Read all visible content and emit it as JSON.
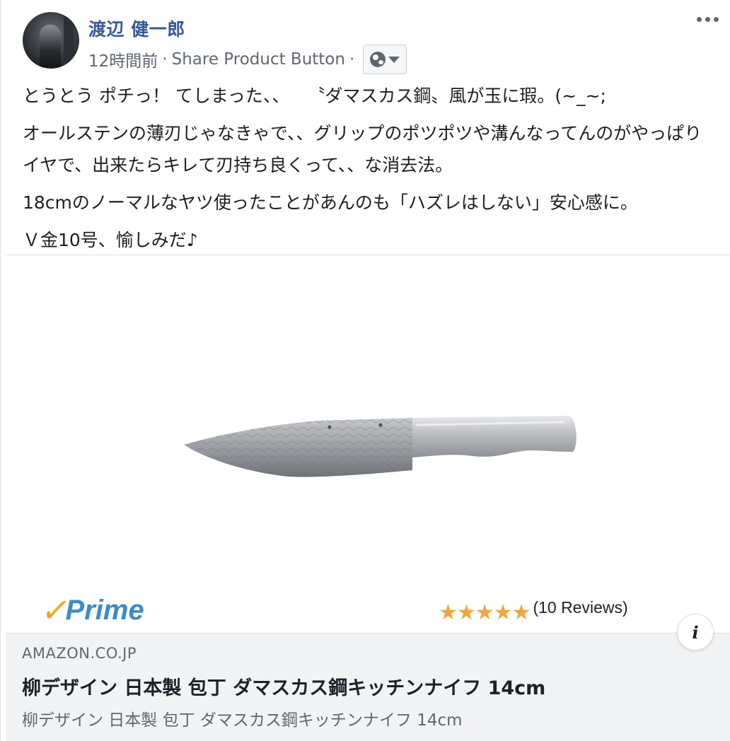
{
  "post": {
    "author": "渡辺 健一郎",
    "time": "12時間前",
    "separator": "·",
    "via": "Share Product Button",
    "audience_icon": "globe-icon",
    "more_icon": "more-options-icon",
    "body": [
      "とうとう ポチっ！ てしまった、、　　〝ダマスカス鋼〟風が玉に瑕。(~_~;",
      "オールステンの薄刃じゃなきゃで、、グリップのポツポツや溝んなってんのがやっぱりイヤで、出来たらキレて刃持ち良くって、、な消去法。",
      "18cmのノーマルなヤツ使ったことがあんのも「ハズレはしない」安心感に。",
      "Ｖ金10号、愉しみだ♪"
    ]
  },
  "product_image": {
    "prime_check": "✓",
    "prime_label": "Prime",
    "stars": "★★★★★",
    "rating_value": 5,
    "reviews_label": "(10 Reviews)"
  },
  "link": {
    "domain": "AMAZON.CO.JP",
    "title": "柳デザイン 日本製 包丁 ダマスカス鋼キッチンナイフ 14cm",
    "description": "柳デザイン 日本製 包丁 ダマスカス鋼キッチンナイフ 14cm",
    "info_label": "i"
  },
  "colors": {
    "author_link": "#385898",
    "meta_text": "#606770",
    "link_box_bg": "#f2f3f5",
    "prime_check": "#f7a41d",
    "prime_text": "#3c8bc7",
    "stars": "#f1a640"
  }
}
